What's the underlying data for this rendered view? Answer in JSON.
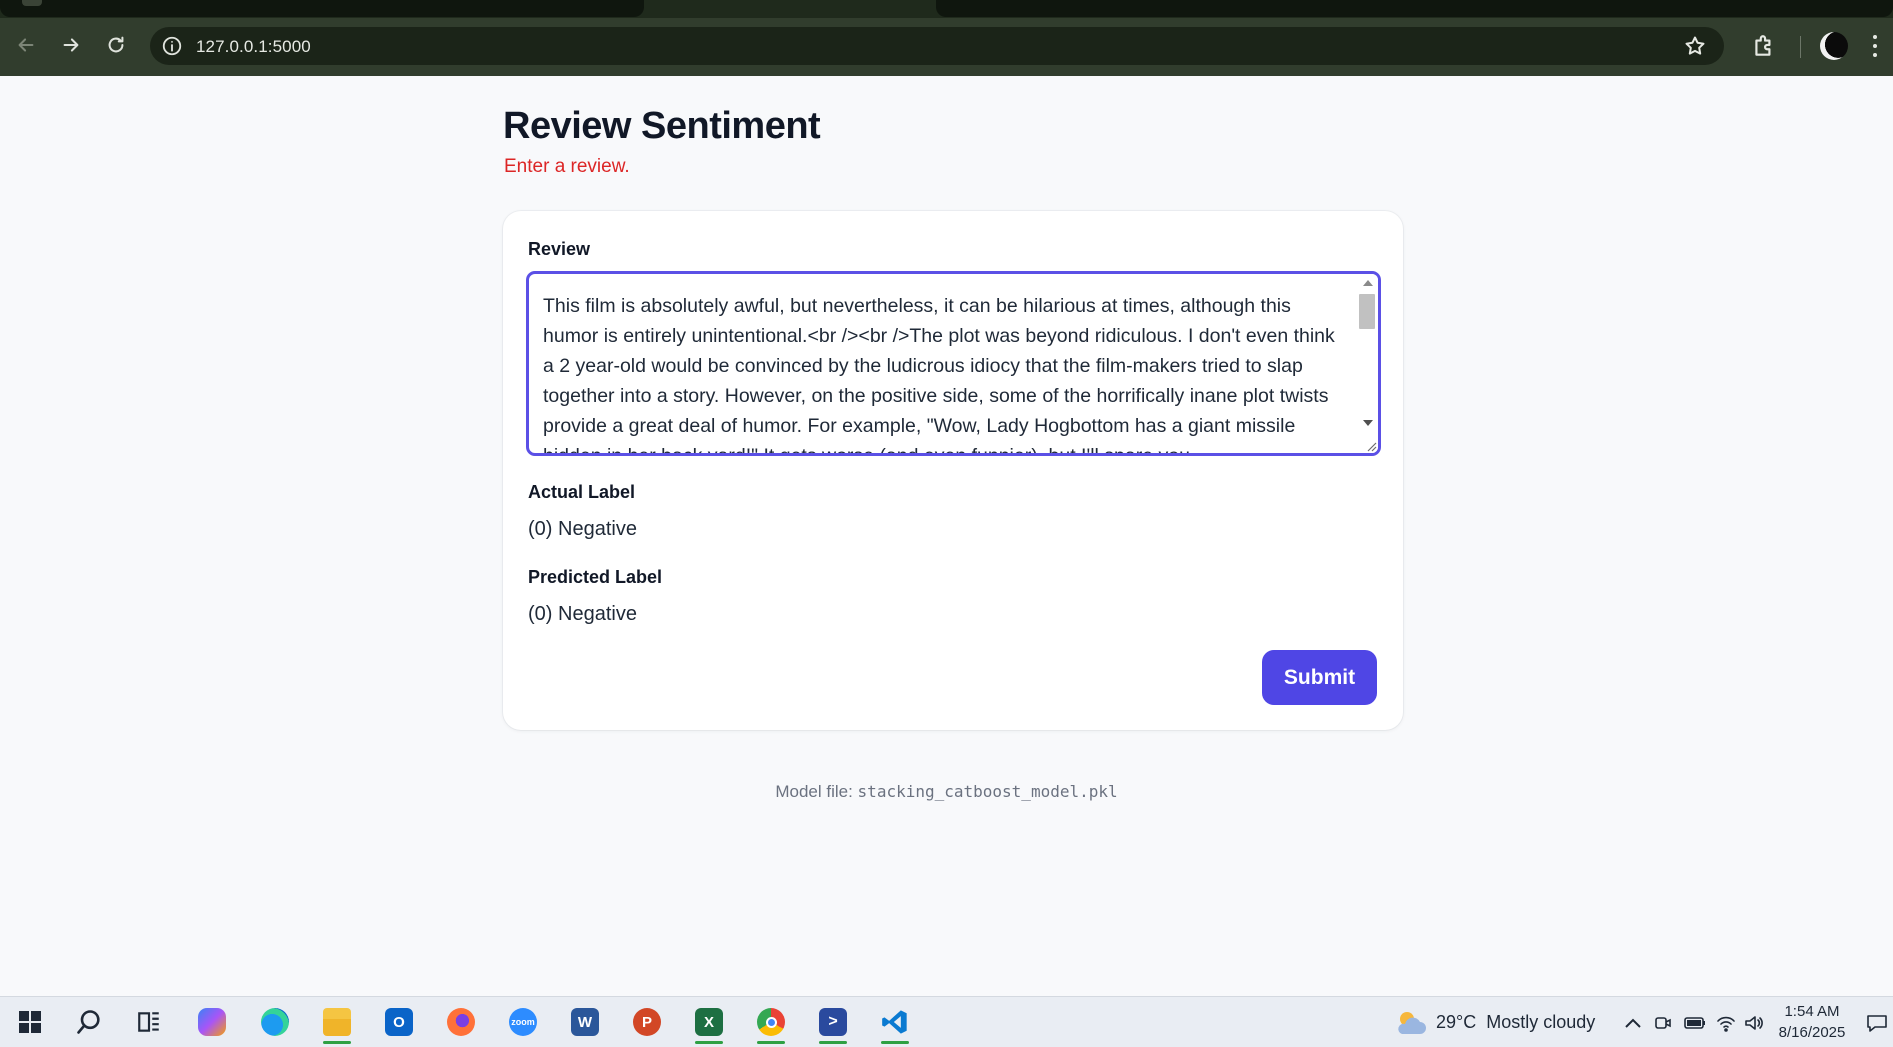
{
  "browser": {
    "url": "127.0.0.1:5000"
  },
  "page": {
    "title": "Review Sentiment",
    "subtitle": "Enter a review."
  },
  "form": {
    "review_label": "Review",
    "review_text": "This film is absolutely awful, but nevertheless, it can be hilarious at times, although this humor is entirely unintentional.<br /><br />The plot was beyond ridiculous. I don't even think a 2 year-old would be convinced by the ludicrous idiocy that the film-makers tried to slap together into a story. However, on the positive side, some of the horrifically inane plot twists provide a great deal of humor. For example, \"Wow, Lady Hogbottom has a giant missile hidden in her back yard!\" It gets worse (and even funnier), but I'll spare you.",
    "actual_label_title": "Actual Label",
    "actual_label_value": "(0) Negative",
    "predicted_label_title": "Predicted Label",
    "predicted_label_value": "(0) Negative",
    "submit_label": "Submit"
  },
  "footer": {
    "prefix": "Model file: ",
    "model_file": "stacking_catboost_model.pkl"
  },
  "taskbar": {
    "apps": [
      "start-icon",
      "search-icon",
      "task-view-icon",
      "copilot-icon",
      "edge-icon",
      "file-explorer-icon",
      "outlook-icon",
      "firefox-icon",
      "zoom-icon",
      "word-icon",
      "powerpoint-icon",
      "excel-icon",
      "chrome-icon",
      "powershell-icon",
      "vscode-icon"
    ],
    "weather_temp": "29°C",
    "weather_desc": "Mostly cloudy",
    "time": "1:54 AM",
    "date": "8/16/2025"
  },
  "colors": {
    "accent": "#4f46e5",
    "subtitle_red": "#dc2626",
    "textarea_border": "#5b50e6"
  }
}
